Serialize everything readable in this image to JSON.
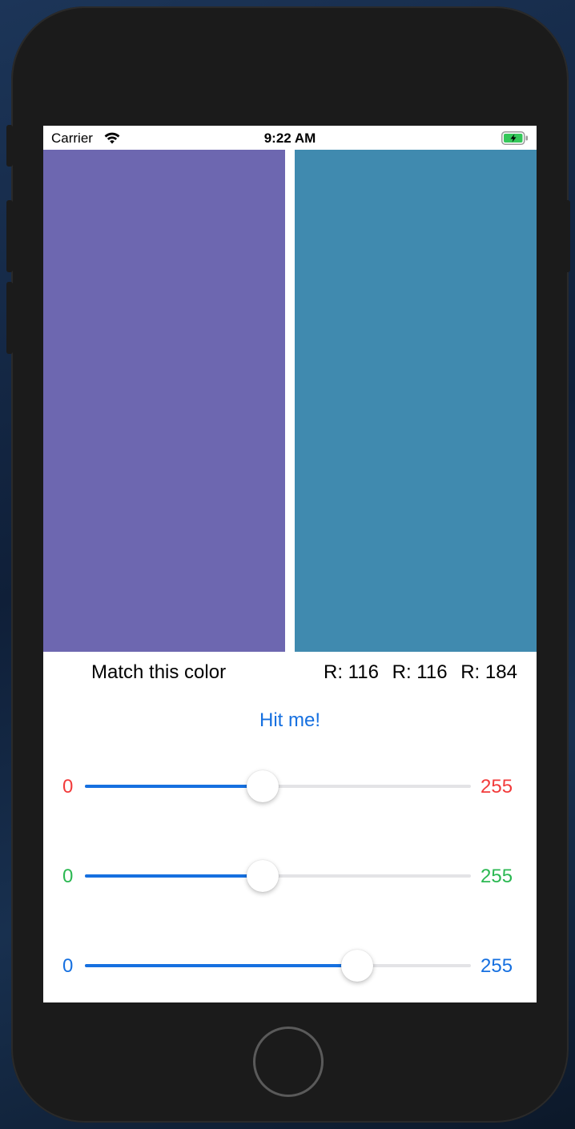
{
  "status_bar": {
    "carrier": "Carrier",
    "time": "9:22 AM",
    "wifi_icon": "wifi-icon",
    "battery_icon": "battery-charging-icon"
  },
  "swatches": {
    "target_color": "#6d67b0",
    "guess_color": "#408aaf"
  },
  "labels": {
    "match_prompt": "Match this color",
    "red_readout": "R: 116",
    "green_readout": "R: 116",
    "blue_readout": "R: 184"
  },
  "hit_button": {
    "label": "Hit me!"
  },
  "sliders": [
    {
      "name": "red",
      "min_label": "0",
      "max_label": "255",
      "color": "#f23b3b",
      "value_fraction": 0.46
    },
    {
      "name": "green",
      "min_label": "0",
      "max_label": "255",
      "color": "#2bb852",
      "value_fraction": 0.46
    },
    {
      "name": "blue",
      "min_label": "0",
      "max_label": "255",
      "color": "#1670e0",
      "value_fraction": 0.706
    }
  ],
  "accent_color": "#1670e0"
}
